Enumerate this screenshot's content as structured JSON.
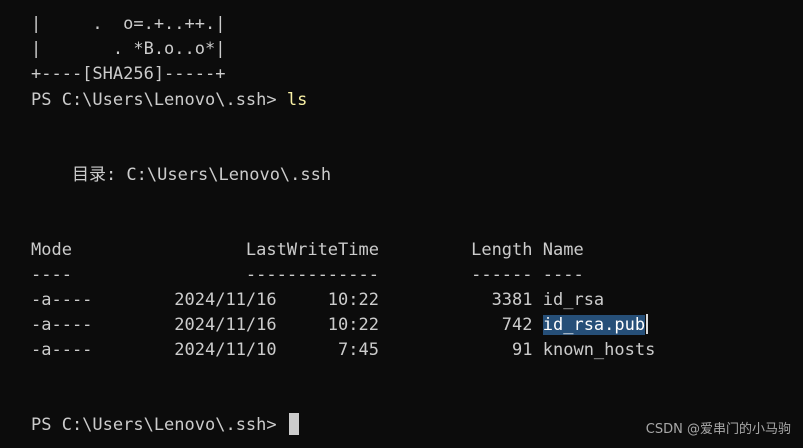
{
  "terminal": {
    "art": [
      "|     .  o=.+..++.|",
      "|       . *B.o..o*|"
    ],
    "art_footer": "+----[SHA256]-----+",
    "prompt1": "PS C:\\Users\\Lenovo\\.ssh> ",
    "command1": "ls",
    "directory_label": "    目录: C:\\Users\\Lenovo\\.ssh",
    "header": "Mode                 LastWriteTime         Length Name",
    "separator": "----                 -------------         ------ ----",
    "rows": [
      {
        "prefix": "-a----        2024/11/16     10:22           3381 ",
        "name": "id_rsa"
      },
      {
        "prefix": "-a----        2024/11/16     10:22            742 ",
        "name": "id_rsa.pub"
      },
      {
        "prefix": "-a----        2024/11/10      7:45             91 ",
        "name": "known_hosts"
      }
    ],
    "prompt2": "PS C:\\Users\\Lenovo\\.ssh> ",
    "selected_file": "id_rsa.pub"
  },
  "watermark": "CSDN @爱串门的小马驹",
  "colors": {
    "background": "#0c0c0c",
    "foreground": "#cccccc",
    "command": "#f9f1a5",
    "selection": "#264f78"
  }
}
